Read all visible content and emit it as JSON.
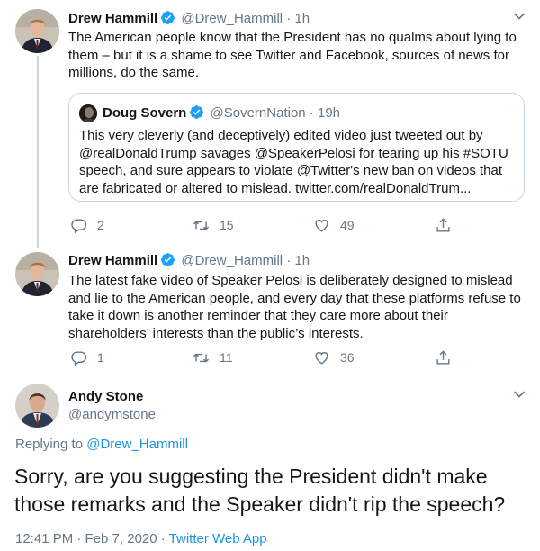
{
  "tweets": [
    {
      "name": "Drew Hammill",
      "handle": "@Drew_Hammill",
      "time": "1h",
      "text": "The American people know that the President has no qualms about lying to them – but it is a shame to see Twitter and Facebook, sources of news for millions, do the same.",
      "quote": {
        "name": "Doug Sovern",
        "handle": "@SovernNation",
        "time": "19h",
        "text": "This very cleverly (and deceptively) edited video just tweeted out by @realDonaldTrump savages @SpeakerPelosi for tearing up his #SOTU  speech, and sure appears to violate @Twitter's new ban on videos that are fabricated or altered to mislead. twitter.com/realDonaldTrum..."
      },
      "replies": "2",
      "retweets": "15",
      "likes": "49"
    },
    {
      "name": "Drew Hammill",
      "handle": "@Drew_Hammill",
      "time": "1h",
      "text": "The latest fake video of Speaker Pelosi is deliberately designed to mislead and lie to the American people, and every day that these platforms refuse to take it down is another reminder that they care more about their shareholders’ interests than the public’s interests.",
      "replies": "1",
      "retweets": "11",
      "likes": "36"
    }
  ],
  "main": {
    "name": "Andy Stone",
    "handle": "@andymstone",
    "replying_label": "Replying to",
    "replying_to": "@Drew_Hammill",
    "text": "Sorry, are you suggesting the President didn't make those remarks and the Speaker didn't rip the speech?",
    "timestamp": "12:41 PM · Feb 7, 2020 ·",
    "source": "Twitter Web App"
  },
  "separator": "·",
  "icons": {
    "verified": "verified-badge-icon",
    "reply": "reply-icon",
    "retweet": "retweet-icon",
    "like": "heart-icon",
    "share": "share-icon",
    "more": "chevron-down-icon"
  },
  "colors": {
    "accent": "#1b95e0",
    "secondary_text": "#657786",
    "primary_text": "#14171a",
    "border": "#ccd6dd"
  }
}
